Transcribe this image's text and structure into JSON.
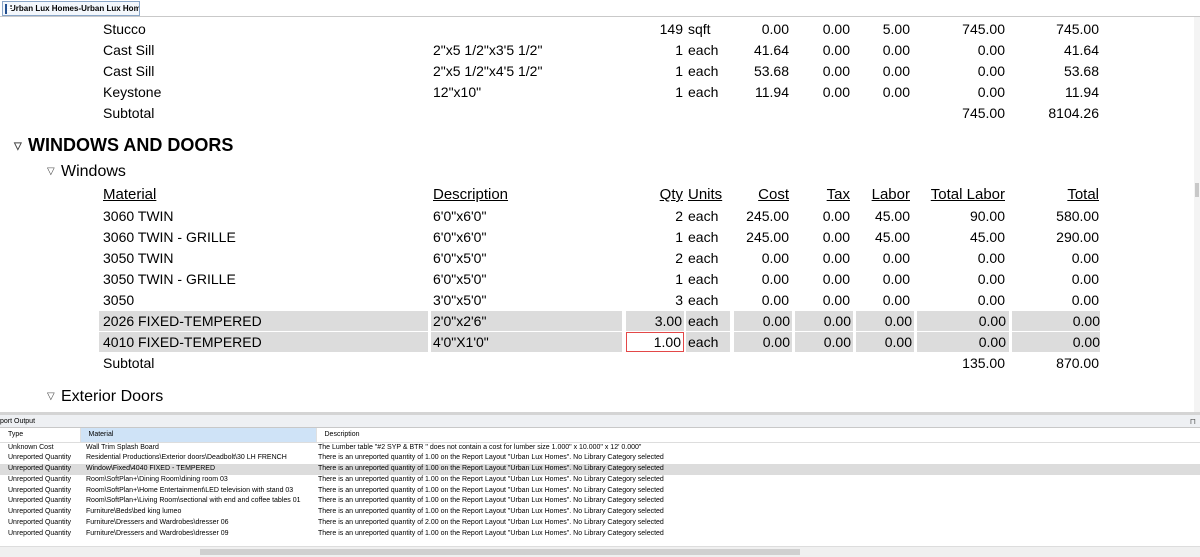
{
  "titlebar": {
    "tab_label": "Urban Lux Homes-Urban Lux Homes"
  },
  "top_rows": [
    {
      "material": "Stucco",
      "description": "",
      "qty": "149",
      "units": "sqft",
      "cost": "0.00",
      "tax": "0.00",
      "labor": "5.00",
      "total_labor": "745.00",
      "total": "745.00"
    },
    {
      "material": "Cast Sill",
      "description": "2\"x5 1/2\"x3'5 1/2\"",
      "qty": "1",
      "units": "each",
      "cost": "41.64",
      "tax": "0.00",
      "labor": "0.00",
      "total_labor": "0.00",
      "total": "41.64"
    },
    {
      "material": "Cast Sill",
      "description": "2\"x5 1/2\"x4'5 1/2\"",
      "qty": "1",
      "units": "each",
      "cost": "53.68",
      "tax": "0.00",
      "labor": "0.00",
      "total_labor": "0.00",
      "total": "53.68"
    },
    {
      "material": "Keystone",
      "description": "12\"x10\"",
      "qty": "1",
      "units": "each",
      "cost": "11.94",
      "tax": "0.00",
      "labor": "0.00",
      "total_labor": "0.00",
      "total": "11.94"
    }
  ],
  "top_subtotal": {
    "label": "Subtotal",
    "total_labor": "745.00",
    "total": "8104.26"
  },
  "section": {
    "title": "WINDOWS AND DOORS"
  },
  "windows": {
    "title": "Windows",
    "headers": {
      "material": "Material",
      "description": "Description",
      "qty": "Qty",
      "units": "Units",
      "cost": "Cost",
      "tax": "Tax",
      "labor": "Labor",
      "total_labor": "Total Labor",
      "total": "Total"
    },
    "rows": [
      {
        "material": "3060 TWIN",
        "description": "6'0\"x6'0\"",
        "qty": "2",
        "units": "each",
        "cost": "245.00",
        "tax": "0.00",
        "labor": "45.00",
        "total_labor": "90.00",
        "total": "580.00"
      },
      {
        "material": "3060 TWIN - GRILLE",
        "description": "6'0\"x6'0\"",
        "qty": "1",
        "units": "each",
        "cost": "245.00",
        "tax": "0.00",
        "labor": "45.00",
        "total_labor": "45.00",
        "total": "290.00"
      },
      {
        "material": "3050 TWIN",
        "description": "6'0\"x5'0\"",
        "qty": "2",
        "units": "each",
        "cost": "0.00",
        "tax": "0.00",
        "labor": "0.00",
        "total_labor": "0.00",
        "total": "0.00"
      },
      {
        "material": "3050 TWIN - GRILLE",
        "description": "6'0\"x5'0\"",
        "qty": "1",
        "units": "each",
        "cost": "0.00",
        "tax": "0.00",
        "labor": "0.00",
        "total_labor": "0.00",
        "total": "0.00"
      },
      {
        "material": "3050",
        "description": "3'0\"x5'0\"",
        "qty": "3",
        "units": "each",
        "cost": "0.00",
        "tax": "0.00",
        "labor": "0.00",
        "total_labor": "0.00",
        "total": "0.00"
      }
    ],
    "selected_rows": [
      {
        "material": "2026 FIXED-TEMPERED",
        "description": "2'0\"x2'6\"",
        "qty": "3.00",
        "units": "each",
        "cost": "0.00",
        "tax": "0.00",
        "labor": "0.00",
        "total_labor": "0.00",
        "total": "0.00"
      },
      {
        "material": "4010 FIXED-TEMPERED",
        "description": "4'0\"X1'0\"",
        "qty": "1.00",
        "units": "each",
        "cost": "0.00",
        "tax": "0.00",
        "labor": "0.00",
        "total_labor": "0.00",
        "total": "0.00"
      }
    ],
    "subtotal": {
      "label": "Subtotal",
      "total_labor": "135.00",
      "total": "870.00"
    }
  },
  "exterior_doors": {
    "title": "Exterior Doors"
  },
  "output": {
    "title": "port Output",
    "columns": [
      "Type",
      "Material",
      "Description"
    ],
    "rows": [
      {
        "type": "Unknown Cost",
        "material": "Wall Trim Splash Board",
        "description": "The Lumber table \"#2 SYP & BTR \" does not contain a cost for lumber size 1.000\" x 10.000\" x 12' 0.000\""
      },
      {
        "type": "Unreported Quantity",
        "material": "Residential Productions\\Exterior doors\\Deadbolt\\30 LH FRENCH",
        "description": "There is an unreported quantity of 1.00 on the Report Layout \"Urban Lux Homes\".  No Library Category selected"
      },
      {
        "type": "Unreported Quantity",
        "material": "Window\\Fixed\\4040 FIXED - TEMPERED",
        "description": "There is an unreported quantity of 1.00 on the Report Layout \"Urban Lux Homes\".  No Library Category selected"
      },
      {
        "type": "Unreported Quantity",
        "material": "Room\\SoftPlan+\\Dining Room\\dining room 03",
        "description": "There is an unreported quantity of 1.00 on the Report Layout \"Urban Lux Homes\".  No Library Category selected"
      },
      {
        "type": "Unreported Quantity",
        "material": "Room\\SoftPlan+\\Home Entertainment\\LED television with stand 03",
        "description": "There is an unreported quantity of 1.00 on the Report Layout \"Urban Lux Homes\".  No Library Category selected"
      },
      {
        "type": "Unreported Quantity",
        "material": "Room\\SoftPlan+\\Living Room\\sectional with end and coffee tables 01",
        "description": "There is an unreported quantity of 1.00 on the Report Layout \"Urban Lux Homes\".  No Library Category selected"
      },
      {
        "type": "Unreported Quantity",
        "material": "Furniture\\Beds\\bed king lumeo",
        "description": "There is an unreported quantity of 1.00 on the Report Layout \"Urban Lux Homes\".  No Library Category selected"
      },
      {
        "type": "Unreported Quantity",
        "material": "Furniture\\Dressers and Wardrobes\\dresser 06",
        "description": "There is an unreported quantity of 2.00 on the Report Layout \"Urban Lux Homes\".  No Library Category selected"
      },
      {
        "type": "Unreported Quantity",
        "material": "Furniture\\Dressers and Wardrobes\\dresser 09",
        "description": "There is an unreported quantity of 1.00 on the Report Layout \"Urban Lux Homes\".  No Library Category selected"
      }
    ],
    "selected_index": 2
  }
}
